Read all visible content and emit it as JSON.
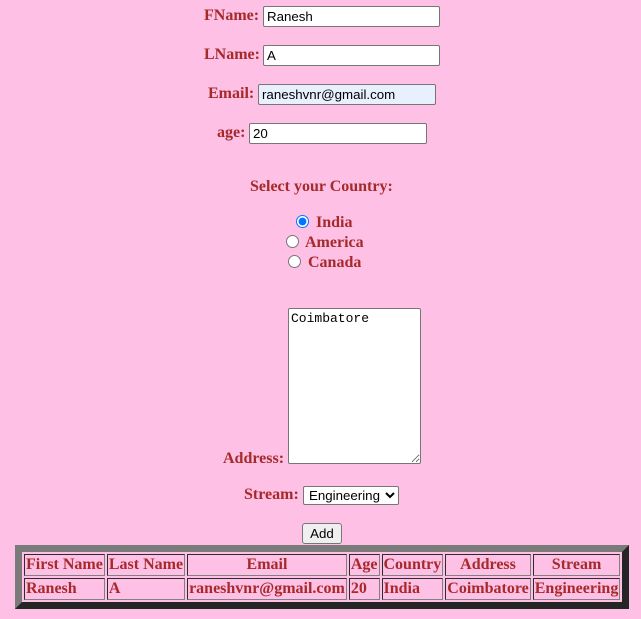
{
  "form": {
    "fname": {
      "label": "FName:",
      "value": "Ranesh"
    },
    "lname": {
      "label": "LName:",
      "value": "A"
    },
    "email": {
      "label": "Email:",
      "value": "raneshvnr@gmail.com"
    },
    "age": {
      "label": "age:",
      "value": "20"
    },
    "country": {
      "heading": "Select your Country:",
      "options": [
        "India",
        "America",
        "Canada"
      ],
      "selected": "India"
    },
    "address": {
      "label": "Address:",
      "value": "Coimbatore"
    },
    "stream": {
      "label": "Stream:",
      "selected": "Engineering"
    },
    "add_label": "Add"
  },
  "table": {
    "headers": [
      "First Name",
      "Last Name",
      "Email",
      "Age",
      "Country",
      "Address",
      "Stream"
    ],
    "rows": [
      [
        "Ranesh",
        "A",
        "raneshvnr@gmail.com",
        "20",
        "India",
        "Coimbatore",
        "Engineering"
      ]
    ]
  }
}
